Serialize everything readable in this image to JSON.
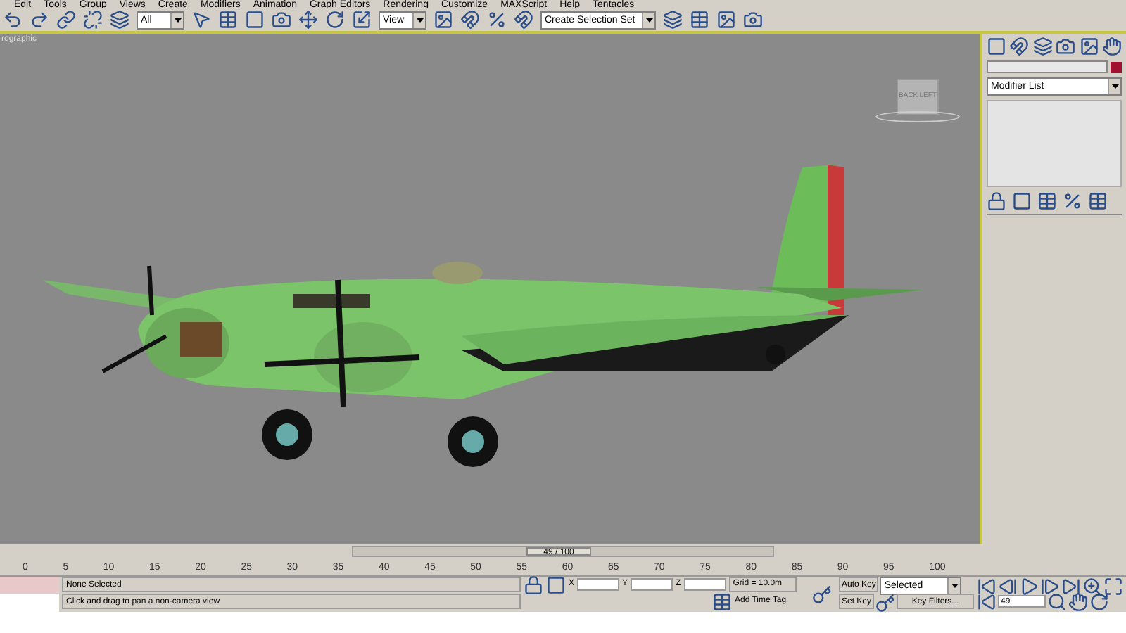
{
  "menu_bar": [
    "Edit",
    "Tools",
    "Group",
    "Views",
    "Create",
    "Modifiers",
    "Animation",
    "Graph Editors",
    "Rendering",
    "Customize",
    "MAXScript",
    "Help",
    "Tentacles"
  ],
  "toolbar": {
    "selection_filter": "All",
    "reference_coord": "View",
    "selection_set": "Create Selection Set"
  },
  "viewport": {
    "label": "rographic",
    "viewcube": [
      "BACK",
      "LEFT"
    ]
  },
  "command_panel": {
    "modifier_list": "Modifier List"
  },
  "time_slider": {
    "text": "49 / 100",
    "level": 0.49
  },
  "ruler_ticks": [
    "0",
    "5",
    "10",
    "15",
    "20",
    "25",
    "30",
    "35",
    "40",
    "45",
    "50",
    "55",
    "60",
    "65",
    "70",
    "75",
    "80",
    "85",
    "90",
    "95",
    "100"
  ],
  "status": {
    "selection": "None Selected",
    "prompt": "Click and drag to pan a non-camera view",
    "x_label": "X",
    "y_label": "Y",
    "z_label": "Z",
    "grid": "Grid = 10.0m",
    "time_tag": "Add Time Tag"
  },
  "animation": {
    "auto_key": "Auto Key",
    "key_mode": "Selected",
    "set_key": "Set Key",
    "key_filters": "Key Filters...",
    "frame": "49"
  }
}
